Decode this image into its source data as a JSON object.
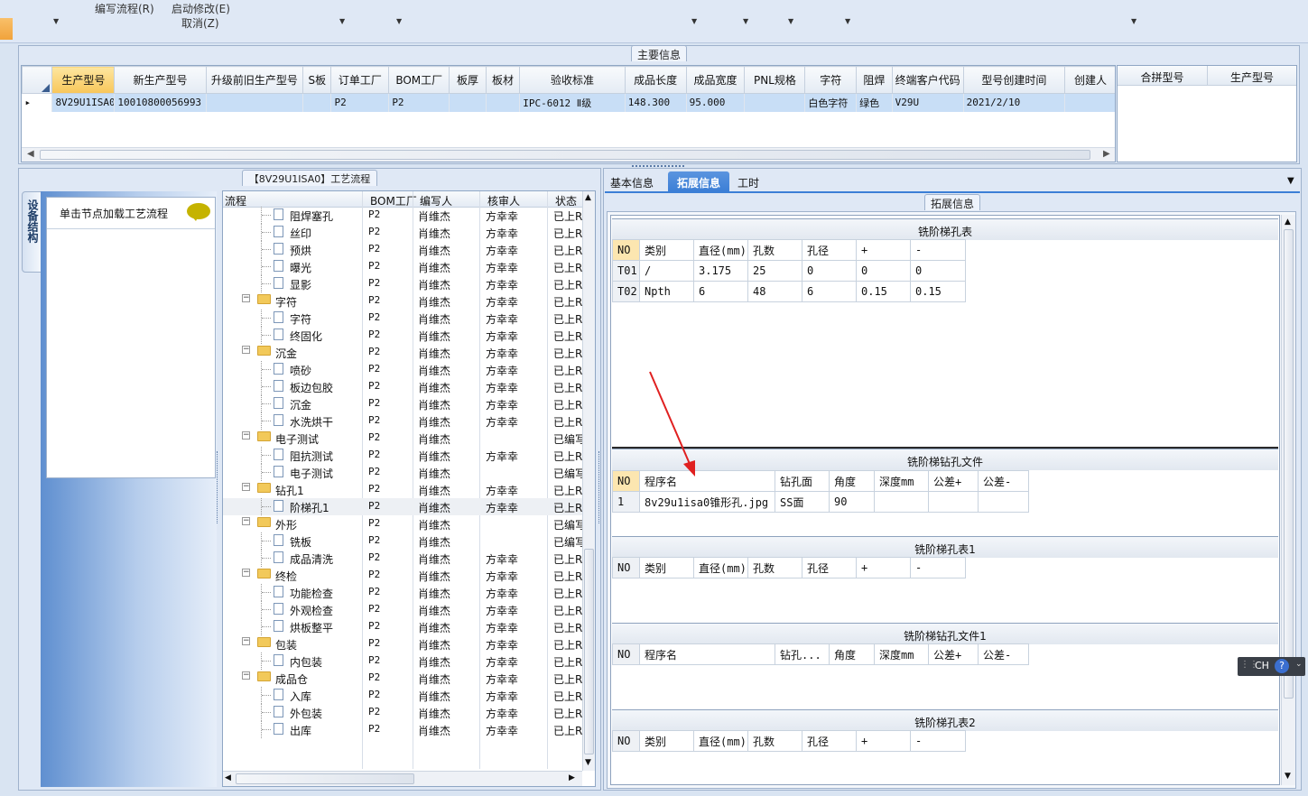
{
  "menu": {
    "write_flow": "编写流程(R)",
    "start_edit": "启动修改(E)",
    "cancel": "取消(Z)"
  },
  "main_info": {
    "caption": "主要信息",
    "columns": [
      "生产型号",
      "新生产型号",
      "升级前旧生产型号",
      "S板",
      "订单工厂",
      "BOM工厂",
      "板厚",
      "板材",
      "验收标准",
      "成品长度",
      "成品宽度",
      "PNL规格",
      "字符",
      "阻焊",
      "终端客户代码",
      "型号创建时间",
      "创建人"
    ],
    "row": [
      "8V29U1ISA0",
      "10010800056993",
      "",
      "",
      "P2",
      "P2",
      "",
      "",
      "IPC-6012 Ⅱ级",
      "148.300",
      "95.000",
      "",
      "白色字符",
      "绿色",
      "V29U",
      "2021/2/10",
      ""
    ],
    "side_columns": [
      "合拼型号",
      "生产型号"
    ]
  },
  "process": {
    "caption": "【8V29U1ISA0】工艺流程",
    "side_tab": "设备结构",
    "hint": "单击节点加载工艺流程",
    "columns": [
      "流程",
      "BOM工厂",
      "编写人",
      "核审人",
      "状态"
    ],
    "rows": [
      {
        "type": "file",
        "name": "阻焊塞孔",
        "bom": "P2",
        "writer": "肖维杰",
        "reviewer": "方幸幸",
        "status": "已上R"
      },
      {
        "type": "file",
        "name": "丝印",
        "bom": "P2",
        "writer": "肖维杰",
        "reviewer": "方幸幸",
        "status": "已上R"
      },
      {
        "type": "file",
        "name": "预烘",
        "bom": "P2",
        "writer": "肖维杰",
        "reviewer": "方幸幸",
        "status": "已上R"
      },
      {
        "type": "file",
        "name": "曝光",
        "bom": "P2",
        "writer": "肖维杰",
        "reviewer": "方幸幸",
        "status": "已上R"
      },
      {
        "type": "file",
        "name": "显影",
        "bom": "P2",
        "writer": "肖维杰",
        "reviewer": "方幸幸",
        "status": "已上R"
      },
      {
        "type": "folder",
        "name": "字符",
        "bom": "P2",
        "writer": "肖维杰",
        "reviewer": "方幸幸",
        "status": "已上R"
      },
      {
        "type": "file",
        "name": "字符",
        "bom": "P2",
        "writer": "肖维杰",
        "reviewer": "方幸幸",
        "status": "已上R"
      },
      {
        "type": "file",
        "name": "终固化",
        "bom": "P2",
        "writer": "肖维杰",
        "reviewer": "方幸幸",
        "status": "已上R"
      },
      {
        "type": "folder",
        "name": "沉金",
        "bom": "P2",
        "writer": "肖维杰",
        "reviewer": "方幸幸",
        "status": "已上R"
      },
      {
        "type": "file",
        "name": "喷砂",
        "bom": "P2",
        "writer": "肖维杰",
        "reviewer": "方幸幸",
        "status": "已上R"
      },
      {
        "type": "file",
        "name": "板边包胶",
        "bom": "P2",
        "writer": "肖维杰",
        "reviewer": "方幸幸",
        "status": "已上R"
      },
      {
        "type": "file",
        "name": "沉金",
        "bom": "P2",
        "writer": "肖维杰",
        "reviewer": "方幸幸",
        "status": "已上R"
      },
      {
        "type": "file",
        "name": "水洗烘干",
        "bom": "P2",
        "writer": "肖维杰",
        "reviewer": "方幸幸",
        "status": "已上R"
      },
      {
        "type": "folder",
        "name": "电子测试",
        "bom": "P2",
        "writer": "肖维杰",
        "reviewer": "",
        "status": "已编写"
      },
      {
        "type": "file",
        "name": "阻抗测试",
        "bom": "P2",
        "writer": "肖维杰",
        "reviewer": "方幸幸",
        "status": "已上R"
      },
      {
        "type": "file",
        "name": "电子测试",
        "bom": "P2",
        "writer": "肖维杰",
        "reviewer": "",
        "status": "已编写"
      },
      {
        "type": "folder",
        "name": "钻孔1",
        "bom": "P2",
        "writer": "肖维杰",
        "reviewer": "方幸幸",
        "status": "已上R"
      },
      {
        "type": "file",
        "name": "阶梯孔1",
        "bom": "P2",
        "writer": "肖维杰",
        "reviewer": "方幸幸",
        "status": "已上R"
      },
      {
        "type": "folder",
        "name": "外形",
        "bom": "P2",
        "writer": "肖维杰",
        "reviewer": "",
        "status": "已编写"
      },
      {
        "type": "file",
        "name": "铣板",
        "bom": "P2",
        "writer": "肖维杰",
        "reviewer": "",
        "status": "已编写"
      },
      {
        "type": "file",
        "name": "成品清洗",
        "bom": "P2",
        "writer": "肖维杰",
        "reviewer": "方幸幸",
        "status": "已上R"
      },
      {
        "type": "folder",
        "name": "终检",
        "bom": "P2",
        "writer": "肖维杰",
        "reviewer": "方幸幸",
        "status": "已上R"
      },
      {
        "type": "file",
        "name": "功能检查",
        "bom": "P2",
        "writer": "肖维杰",
        "reviewer": "方幸幸",
        "status": "已上R"
      },
      {
        "type": "file",
        "name": "外观检查",
        "bom": "P2",
        "writer": "肖维杰",
        "reviewer": "方幸幸",
        "status": "已上R"
      },
      {
        "type": "file",
        "name": "烘板整平",
        "bom": "P2",
        "writer": "肖维杰",
        "reviewer": "方幸幸",
        "status": "已上R"
      },
      {
        "type": "folder",
        "name": "包装",
        "bom": "P2",
        "writer": "肖维杰",
        "reviewer": "方幸幸",
        "status": "已上R"
      },
      {
        "type": "file",
        "name": "内包装",
        "bom": "P2",
        "writer": "肖维杰",
        "reviewer": "方幸幸",
        "status": "已上R"
      },
      {
        "type": "folder",
        "name": "成品仓",
        "bom": "P2",
        "writer": "肖维杰",
        "reviewer": "方幸幸",
        "status": "已上R"
      },
      {
        "type": "file",
        "name": "入库",
        "bom": "P2",
        "writer": "肖维杰",
        "reviewer": "方幸幸",
        "status": "已上R"
      },
      {
        "type": "file",
        "name": "外包装",
        "bom": "P2",
        "writer": "肖维杰",
        "reviewer": "方幸幸",
        "status": "已上R"
      },
      {
        "type": "file",
        "name": "出库",
        "bom": "P2",
        "writer": "肖维杰",
        "reviewer": "方幸幸",
        "status": "已上R"
      }
    ]
  },
  "tabs": [
    "基本信息",
    "拓展信息",
    "工时"
  ],
  "ext_caption": "拓展信息",
  "sections": {
    "t1_title": "铣阶梯孔表",
    "t1_cols": [
      "NO",
      "类别",
      "直径(mm)",
      "孔数",
      "孔径",
      "+",
      "-"
    ],
    "t1_rows": [
      [
        "T01",
        "/",
        "3.175",
        "25",
        "0",
        "0",
        "0"
      ],
      [
        "T02",
        "Npth",
        "6",
        "48",
        "6",
        "0.15",
        "0.15"
      ]
    ],
    "t2_title": "铣阶梯钻孔文件",
    "t2_cols": [
      "NO",
      "程序名",
      "钻孔面",
      "角度",
      "深度mm",
      "公差+",
      "公差-"
    ],
    "t2_rows": [
      [
        "1",
        "8v29u1isa0锥形孔.jpg",
        "SS面",
        "90",
        "",
        "",
        ""
      ]
    ],
    "t3_title": "铣阶梯孔表1",
    "t3_cols": [
      "NO",
      "类别",
      "直径(mm)",
      "孔数",
      "孔径",
      "+",
      "-"
    ],
    "t4_title": "铣阶梯钻孔文件1",
    "t4_cols": [
      "NO",
      "程序名",
      "钻孔...",
      "角度",
      "深度mm",
      "公差+",
      "公差-"
    ],
    "t5_title": "铣阶梯孔表2",
    "t5_cols": [
      "NO",
      "类别",
      "直径(mm)",
      "孔数",
      "孔径",
      "+",
      "-"
    ]
  },
  "ime": {
    "label": "CH"
  },
  "colors": {
    "accent": "#3c7fd6",
    "selected_row": "#c8def6",
    "header_sel": "#f8c65a",
    "arrow": "#e02020"
  }
}
